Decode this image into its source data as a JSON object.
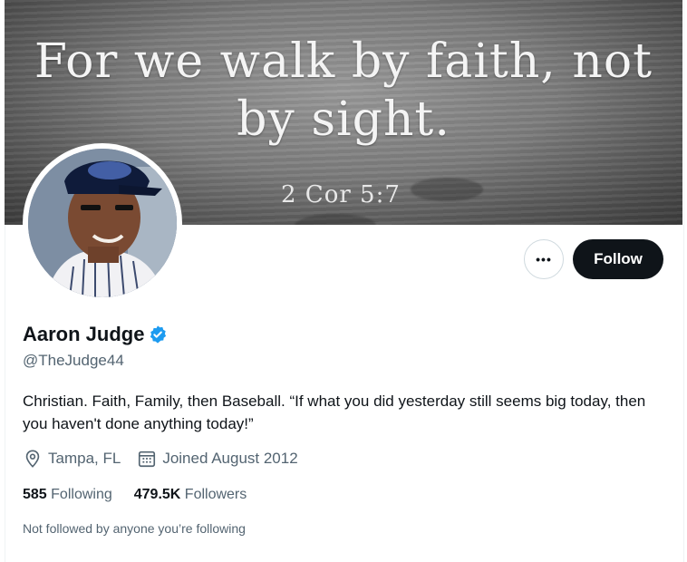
{
  "banner": {
    "quote_line1": "For we walk by faith, not",
    "quote_line2": "by sight.",
    "reference": "2 Cor 5:7"
  },
  "profile": {
    "name": "Aaron Judge",
    "handle": "@TheJudge44",
    "bio": "Christian. Faith, Family, then Baseball. “If what you did yesterday still seems big today, then you haven't done anything today!”",
    "location": "Tampa, FL",
    "joined": "Joined August 2012",
    "following_count": "585",
    "following_label": "Following",
    "followers_count": "479.5K",
    "followers_label": "Followers",
    "followed_by_note": "Not followed by anyone you’re following"
  },
  "actions": {
    "more_label": "•••",
    "follow_label": "Follow"
  },
  "icons": {
    "verified": "verified-badge-icon",
    "location": "location-pin-icon",
    "calendar": "calendar-icon",
    "more": "more-options-icon"
  },
  "colors": {
    "verified_blue": "#1d9bf0",
    "follow_bg": "#0f1419",
    "secondary_text": "#536471"
  }
}
